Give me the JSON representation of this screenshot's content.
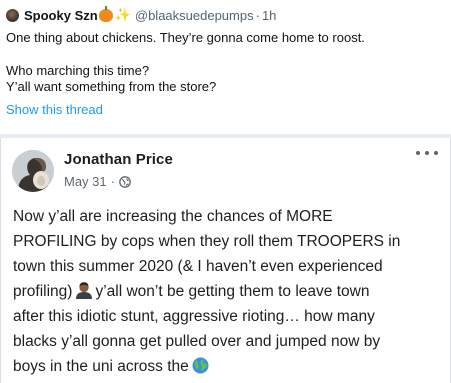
{
  "tweet": {
    "display_name": "Spooky Szn",
    "display_name_emojis": [
      "pumpkin-emoji",
      "sparkles-emoji"
    ],
    "handle": "@blaaksuedepumps",
    "separator": "·",
    "time": "1h",
    "lines": [
      "One thing about chickens. They’re gonna come home to roost.",
      "",
      "Who marching this time?",
      "Y’all want something from the store?"
    ],
    "show_thread": "Show this thread",
    "colors": {
      "link": "#1d9bf0",
      "secondary": "#536471"
    }
  },
  "facebook_post": {
    "author": "Jonathan Price",
    "date": "May 31",
    "separator": "·",
    "audience_icon": "globe-icon",
    "more_icon": "more-options-icon",
    "body": {
      "line1": "Now y’all are increasing the chances of MORE",
      "line2": "PROFILING by cops when they roll them TROOPERS in",
      "line3": "town this summer 2020 (& I haven’t even experienced",
      "line4_before_emoji": "profiling)",
      "line4_emoji": "man-emoji",
      "line4_after_emoji": "y’all won’t be getting them to leave town",
      "line5": "after this idiotic stunt, aggressive rioting… how many",
      "line6": "blacks y’all gonna get pulled over and jumped now by",
      "line7_before_emoji": "boys in the uni across the",
      "line7_emoji": "globe-emoji"
    },
    "colors": {
      "text": "#1c1e21",
      "secondary": "#606770",
      "border": "#dddfe2"
    }
  }
}
